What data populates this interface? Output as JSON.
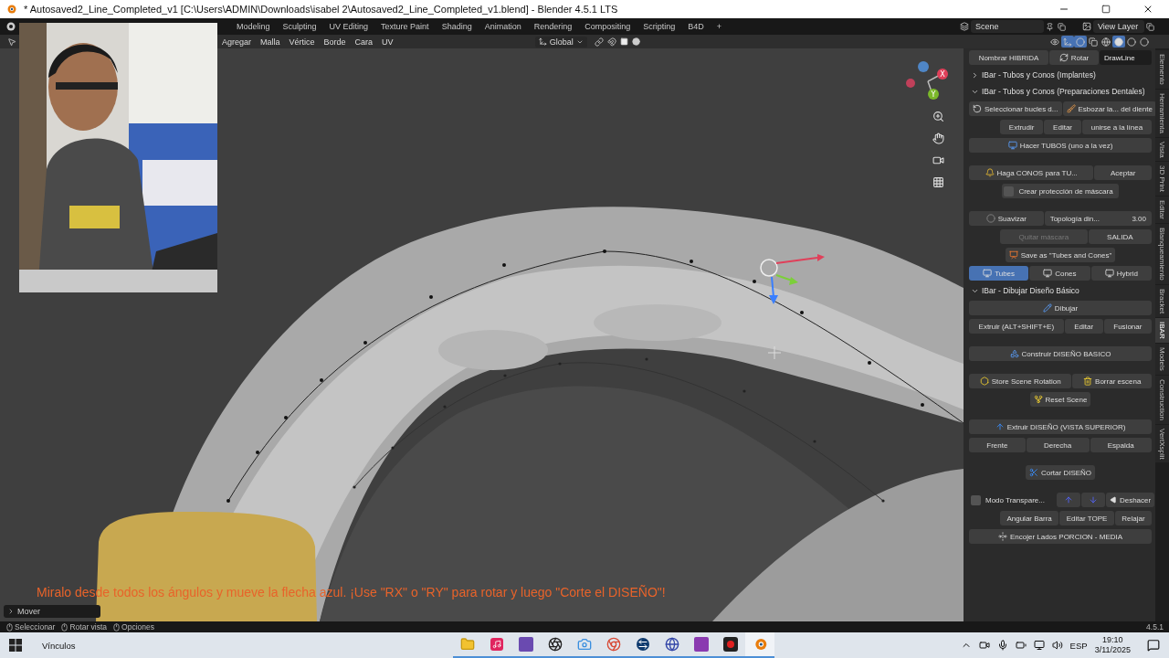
{
  "window": {
    "title": "* Autosaved2_Line_Completed_v1 [C:\\Users\\ADMIN\\Downloads\\isabel 2\\Autosaved2_Line_Completed_v1.blend] - Blender 4.5.1 LTS"
  },
  "workspaces": [
    {
      "label": "Modeling",
      "selected": false
    },
    {
      "label": "Sculpting",
      "selected": false
    },
    {
      "label": "UV Editing",
      "selected": false
    },
    {
      "label": "Texture Paint",
      "selected": false
    },
    {
      "label": "Shading",
      "selected": false
    },
    {
      "label": "Animation",
      "selected": false
    },
    {
      "label": "Rendering",
      "selected": false
    },
    {
      "label": "Compositing",
      "selected": false
    },
    {
      "label": "Scripting",
      "selected": false
    },
    {
      "label": "B4D",
      "selected": false
    }
  ],
  "add_workspace": "+",
  "scene": "Scene",
  "view_layer": "View Layer",
  "menus": [
    "Agregar",
    "Malla",
    "Vértice",
    "Borde",
    "Cara",
    "UV"
  ],
  "orientation": "Global",
  "nav_gizmo": {
    "labels": [
      "X",
      "Y"
    ]
  },
  "caption": "Miralo desde todos los ángulos y mueve la flecha azul. ¡Use \"RX\" o \"RY\" para rotar y luego \"Corte el DISEÑO\"!",
  "operator_panel": {
    "label": "Mover",
    "expanded": false
  },
  "panel": {
    "groups": [
      [
        {
          "kind": "row",
          "items": [
            {
              "kind": "button",
              "label": "Nombrar HIBRIDA"
            },
            {
              "kind": "button",
              "label": "Rotar"
            },
            {
              "kind": "field",
              "value": "DrawLine"
            }
          ]
        },
        {
          "kind": "header",
          "label": "IBar - Tubos y Conos (Implantes)",
          "expanded": false
        },
        {
          "kind": "header",
          "label": "IBar - Tubos y Conos (Preparaciones Dentales)",
          "expanded": true
        },
        {
          "kind": "row",
          "items": [
            {
              "kind": "button",
              "label": "Seleccionar bucles d..."
            },
            {
              "kind": "button",
              "label": "Esbozar la... del diente"
            }
          ]
        },
        {
          "kind": "sub",
          "items": [
            {
              "kind": "button",
              "label": "Extrudir"
            },
            {
              "kind": "button",
              "label": "Editar"
            },
            {
              "kind": "button",
              "label": "unirse a la línea"
            }
          ]
        },
        {
          "kind": "row",
          "items": [
            {
              "kind": "button",
              "label": "Hacer TUBOS (uno a la vez)"
            }
          ]
        }
      ],
      [
        {
          "kind": "row",
          "items": [
            {
              "kind": "button",
              "label": "Haga CONOS para TU..."
            },
            {
              "kind": "button",
              "label": "Aceptar"
            }
          ]
        },
        {
          "kind": "center",
          "items": [
            {
              "kind": "checkbox",
              "label": "Crear protección de máscara",
              "checked": false
            }
          ]
        }
      ],
      [
        {
          "kind": "row",
          "items": [
            {
              "kind": "button",
              "label": "Suavizar"
            },
            {
              "kind": "number",
              "label": "Topología din...",
              "value": "3.00"
            }
          ]
        },
        {
          "kind": "sub",
          "items": [
            {
              "kind": "button",
              "label": "Quitar máscara",
              "disabled": true
            },
            {
              "kind": "button",
              "label": "SALIDA",
              "disabled": false
            }
          ]
        },
        {
          "kind": "center",
          "items": [
            {
              "kind": "button",
              "label": "Save as \"Tubes and Cones\""
            }
          ]
        },
        {
          "kind": "row",
          "items": [
            {
              "kind": "button",
              "label": "Tubes",
              "selected": true
            },
            {
              "kind": "button",
              "label": "Cones",
              "selected": false
            },
            {
              "kind": "button",
              "label": "Hybrid",
              "selected": false
            }
          ]
        },
        {
          "kind": "header",
          "label": "IBar - Dibujar Diseño Básico",
          "expanded": true
        },
        {
          "kind": "row",
          "items": [
            {
              "kind": "button",
              "label": "Dibujar"
            }
          ]
        },
        {
          "kind": "row",
          "items": [
            {
              "kind": "button",
              "label": "Extruir (ALT+SHIFT+E)"
            },
            {
              "kind": "button",
              "label": "Editar"
            },
            {
              "kind": "button",
              "label": "Fusionar"
            }
          ]
        }
      ],
      [
        {
          "kind": "row",
          "items": [
            {
              "kind": "button",
              "label": "Construir DISEÑO BASICO"
            }
          ]
        }
      ],
      [
        {
          "kind": "row",
          "items": [
            {
              "kind": "button",
              "label": "Store Scene Rotation"
            },
            {
              "kind": "button",
              "label": "Borrar escena"
            }
          ]
        },
        {
          "kind": "center",
          "items": [
            {
              "kind": "button",
              "label": "Reset Scene"
            }
          ]
        }
      ],
      [
        {
          "kind": "row",
          "items": [
            {
              "kind": "button",
              "label": "Extruir DISEÑO (VISTA SUPERIOR)"
            }
          ]
        },
        {
          "kind": "row",
          "items": [
            {
              "kind": "button",
              "label": "Frente"
            },
            {
              "kind": "button",
              "label": "Derecha"
            },
            {
              "kind": "button",
              "label": "Espalda"
            }
          ]
        }
      ],
      [
        {
          "kind": "center",
          "items": [
            {
              "kind": "button",
              "label": "Cortar DISEÑO"
            }
          ]
        }
      ],
      [
        {
          "kind": "row",
          "items": [
            {
              "kind": "checkbox",
              "label": "Modo Transpare...",
              "checked": false
            },
            {
              "kind": "icon"
            },
            {
              "kind": "icon"
            },
            {
              "kind": "button",
              "label": "Deshacer"
            }
          ]
        },
        {
          "kind": "sub",
          "items": [
            {
              "kind": "button",
              "label": "Angular Barra"
            },
            {
              "kind": "button",
              "label": "Editar TOPE"
            },
            {
              "kind": "button",
              "label": "Relajar"
            }
          ]
        },
        {
          "kind": "row",
          "items": [
            {
              "kind": "button",
              "label": "Encojer Lados PORCION - MEDIA"
            }
          ]
        }
      ]
    ]
  },
  "sidebar_tabs": [
    {
      "label": "Elemento",
      "selected": false
    },
    {
      "label": "Herramienta",
      "selected": false
    },
    {
      "label": "Vista",
      "selected": false
    },
    {
      "label": "3D Print",
      "selected": false
    },
    {
      "label": "Editar",
      "selected": false
    },
    {
      "label": "Blanqueamiento",
      "selected": false
    },
    {
      "label": "Bracket",
      "selected": false
    },
    {
      "label": "IBAR",
      "selected": true
    },
    {
      "label": "Models",
      "selected": false
    },
    {
      "label": "Construction",
      "selected": false
    },
    {
      "label": "VertXsplit",
      "selected": false
    }
  ],
  "status_bar": {
    "hints": [
      "Seleccionar",
      "Rotar vista",
      "Opciones"
    ],
    "version": "4.5.1"
  },
  "taskbar": {
    "links": "Vínculos",
    "language": "ESP",
    "time": "19:10",
    "date": "3/11/2025"
  }
}
